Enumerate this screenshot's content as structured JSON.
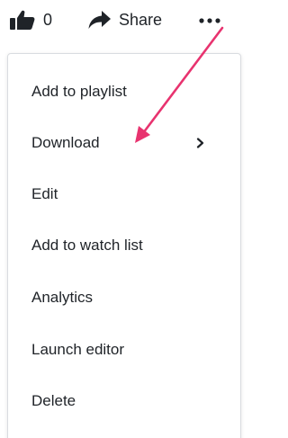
{
  "action_bar": {
    "like": {
      "icon": "thumbs-up-icon",
      "count": "0"
    },
    "share": {
      "icon": "share-arrow-icon",
      "label": "Share"
    },
    "more": {
      "icon": "more-dots-icon"
    }
  },
  "menu": {
    "items": [
      {
        "label": "Add to playlist"
      },
      {
        "label": "Download",
        "submenu_icon": "chevron-right-icon"
      },
      {
        "label": "Edit"
      },
      {
        "label": "Add to watch list"
      },
      {
        "label": "Analytics"
      },
      {
        "label": "Launch editor"
      },
      {
        "label": "Delete"
      }
    ]
  },
  "annotation": {
    "icon": "pointer-arrow-icon",
    "color": "#e8336f"
  },
  "colors": {
    "text": "#1f2328",
    "menu_border": "#d9dce0",
    "background": "#ffffff"
  }
}
